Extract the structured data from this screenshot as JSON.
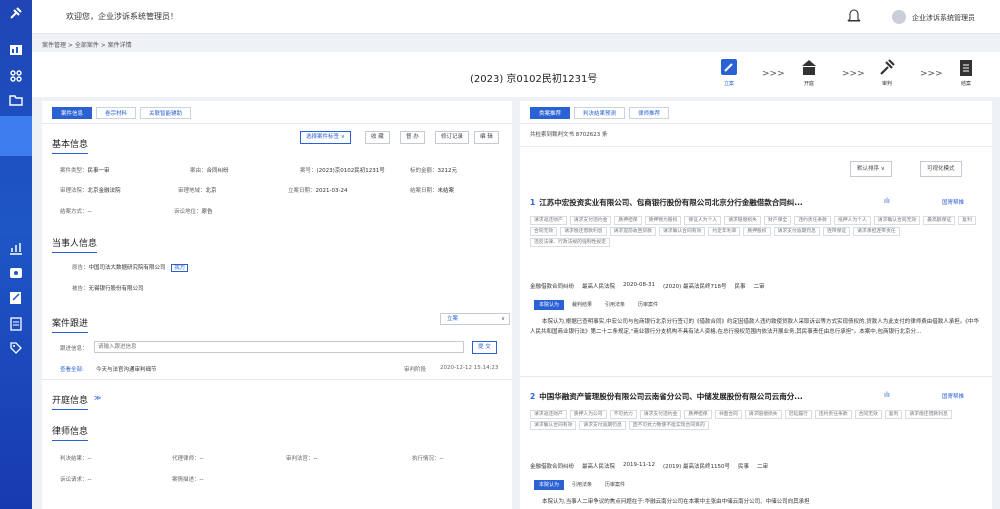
{
  "topbar": {
    "welcome": "欢迎您，企业涉诉系统管理员！",
    "username": "企业涉诉系统管理员"
  },
  "breadcrumb": "案件管理 > 全部案件 > 案件详情",
  "case_no": "(2023) 京0102民初1231号",
  "steps": [
    {
      "label": "立案",
      "active": true
    },
    {
      "label": "开庭",
      "active": false
    },
    {
      "label": "审判",
      "active": false
    },
    {
      "label": "结案",
      "active": false
    }
  ],
  "arrows": ">>>",
  "left_tabs": [
    "案件信息",
    "卷宗材料",
    "关联智能辅助"
  ],
  "basic": {
    "title": "基本信息",
    "buttons": [
      "选择案件标签 ∨",
      "收 藏",
      "督 办",
      "修订记录",
      "编 辑"
    ],
    "fields": [
      [
        "案件类型：",
        "民事一审"
      ],
      [
        "案由：",
        "合同纠纷"
      ],
      [
        "案号：",
        "(2023)京0102民初1231号"
      ],
      [
        "标的金额：",
        "3212元"
      ],
      [
        "审理法院：",
        "北京金融法院"
      ],
      [
        "审理地域：",
        "北京"
      ],
      [
        "立案日期：",
        "2021-03-24"
      ],
      [
        "结案日期：",
        "未结案"
      ],
      [
        "结案方式：",
        "--"
      ],
      [
        "诉讼地位：",
        "原告"
      ]
    ]
  },
  "parties": {
    "title": "当事人信息",
    "plaintiff_label": "原告：",
    "plaintiff": "中国司法大数据研究院有限公司",
    "plaintiff_badge": "我方",
    "defendant_label": "被告：",
    "defendant": "无锡银行股份有限公司"
  },
  "progress": {
    "title": "案件跟进",
    "select": "立案",
    "input_label": "跟进信息：",
    "placeholder": "请输入跟进信息",
    "submit": "提 交",
    "view_all": "查看全部:",
    "latest": "今天与法官沟通审判细节",
    "stage_label": "审判阶段",
    "time": "2020-12-12  15:14:23"
  },
  "hearing": {
    "title": "开庭信息"
  },
  "lawyer": {
    "title": "律师信息",
    "fields": [
      [
        "判决结果：",
        "--"
      ],
      [
        "代理律师：",
        "--"
      ],
      [
        "审判法官：",
        "--"
      ],
      [
        "执行情况：",
        "--"
      ],
      [
        "诉讼请求：",
        "--"
      ],
      [
        "案情描述：",
        "--"
      ]
    ]
  },
  "right": {
    "tabs": [
      "类案推荐",
      "判决结果预测",
      "律师推荐"
    ],
    "count": "共检索到裁判文书 8702623 条",
    "sort": "默认排序 ∨",
    "viz": "可视化模式",
    "results": [
      {
        "n": "1",
        "title": "江苏中宏投资实业有限公司、包商银行股份有限公司北京分行金融借款合同纠...",
        "link": "国寄帮推",
        "tags": [
          "请求返还财产",
          "请求支付违约金",
          "质押担保",
          "质押物为股权",
          "保证人为个人",
          "请求赔偿损失",
          "财产保全",
          "违约责任条款",
          "抵押人为个人",
          "请求确认合同无效",
          "最高额保证",
          "复利",
          "合同无效",
          "请求偿还借款利息",
          "请求提前收回贷款",
          "请求确认合同有效",
          "约定年利率",
          "质押股权",
          "请求支付逾期罚息",
          "连带保证",
          "请求承担连带责任",
          "违反法律、行政法规的强制性规定"
        ],
        "meta": [
          "金融借款合同纠纷",
          "最高人民法院",
          "2020-08-31",
          "(2020) 最高法民终718号",
          "民事",
          "二审"
        ],
        "subtabs": [
          "本院认为",
          "裁判结果",
          "引用法条",
          "历审案件"
        ],
        "text": "本院认为,根据已查明事实,中宏公司与包商银行北京分行签订的《借款合同》约定因借款人违约致使贷款人采取诉讼等方式实现债权的,贷款人为此支付的律师费由借款人承担。《中华人民共和国商业银行法》第二十二条规定,\"商业银行分支机构不具有法人资格,在总行授权范围内依法开展业务,其民事责任由总行承担\"。本案中,包商银行北京分..."
      },
      {
        "n": "2",
        "title": "中国华融资产管理股份有限公司云南省分公司、中储发展股份有限公司云南分...",
        "link": "国寄帮推",
        "tags": [
          "请求返还财产",
          "质押人为公司",
          "不可抗力",
          "请求支付违约金",
          "质押担保",
          "书面合同",
          "请求赔偿损失",
          "迟延履行",
          "违约责任条款",
          "合同无效",
          "复利",
          "请求偿还借款利息",
          "请求确认合同有效",
          "请求支付逾期罚息",
          "因不可抗力致使不能实现合同目的"
        ],
        "meta": [
          "金融借款合同纠纷",
          "最高人民法院",
          "2019-11-12",
          "(2019) 最高法民终1150号",
          "民事",
          "二审"
        ],
        "subtabs": [
          "本院认为",
          "引用法条",
          "历审案件"
        ],
        "text": "本院认为,当事人二审争议的焦点问题在于:华融云南分公司在本案中主张由中储云南分公司、中储公司向其承担"
      }
    ]
  }
}
